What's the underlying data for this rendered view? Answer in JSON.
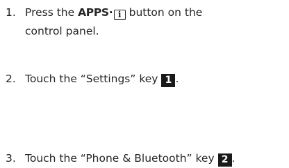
{
  "steps": [
    {
      "number": "1.",
      "text_before": "Press the ",
      "button_label": "APPS",
      "button_separator": "·",
      "button_icon_glyph": "i",
      "text_after": " button on the",
      "continuation": "control panel."
    },
    {
      "number": "2.",
      "text": "Touch the “Settings” key",
      "badge": "1",
      "end": "."
    },
    {
      "number": "3.",
      "text": "Touch the “Phone & Bluetooth” key",
      "badge": "2",
      "end": "."
    }
  ],
  "colors": {
    "text": "#262626",
    "badge_bg": "#1a1a1a",
    "badge_fg": "#ffffff"
  },
  "icons": {
    "apps_button_icon": "info-icon"
  }
}
